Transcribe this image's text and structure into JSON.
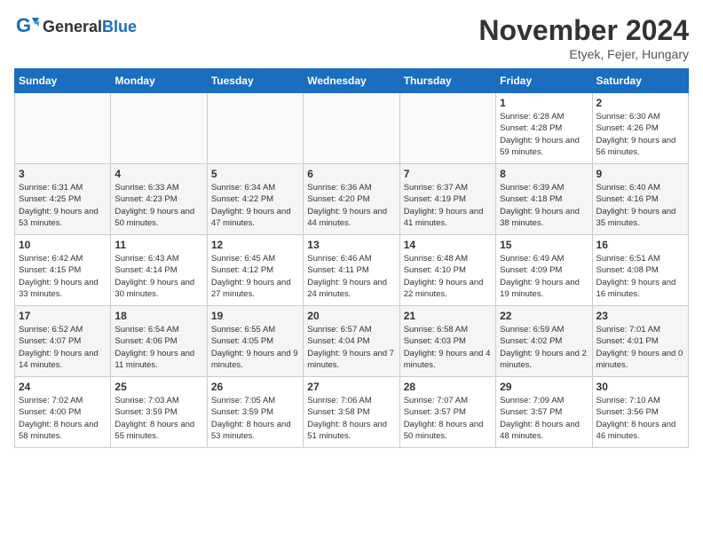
{
  "logo": {
    "general": "General",
    "blue": "Blue"
  },
  "title": "November 2024",
  "location": "Etyek, Fejer, Hungary",
  "weekdays": [
    "Sunday",
    "Monday",
    "Tuesday",
    "Wednesday",
    "Thursday",
    "Friday",
    "Saturday"
  ],
  "weeks": [
    [
      {
        "day": "",
        "info": ""
      },
      {
        "day": "",
        "info": ""
      },
      {
        "day": "",
        "info": ""
      },
      {
        "day": "",
        "info": ""
      },
      {
        "day": "",
        "info": ""
      },
      {
        "day": "1",
        "info": "Sunrise: 6:28 AM\nSunset: 4:28 PM\nDaylight: 9 hours and 59 minutes."
      },
      {
        "day": "2",
        "info": "Sunrise: 6:30 AM\nSunset: 4:26 PM\nDaylight: 9 hours and 56 minutes."
      }
    ],
    [
      {
        "day": "3",
        "info": "Sunrise: 6:31 AM\nSunset: 4:25 PM\nDaylight: 9 hours and 53 minutes."
      },
      {
        "day": "4",
        "info": "Sunrise: 6:33 AM\nSunset: 4:23 PM\nDaylight: 9 hours and 50 minutes."
      },
      {
        "day": "5",
        "info": "Sunrise: 6:34 AM\nSunset: 4:22 PM\nDaylight: 9 hours and 47 minutes."
      },
      {
        "day": "6",
        "info": "Sunrise: 6:36 AM\nSunset: 4:20 PM\nDaylight: 9 hours and 44 minutes."
      },
      {
        "day": "7",
        "info": "Sunrise: 6:37 AM\nSunset: 4:19 PM\nDaylight: 9 hours and 41 minutes."
      },
      {
        "day": "8",
        "info": "Sunrise: 6:39 AM\nSunset: 4:18 PM\nDaylight: 9 hours and 38 minutes."
      },
      {
        "day": "9",
        "info": "Sunrise: 6:40 AM\nSunset: 4:16 PM\nDaylight: 9 hours and 35 minutes."
      }
    ],
    [
      {
        "day": "10",
        "info": "Sunrise: 6:42 AM\nSunset: 4:15 PM\nDaylight: 9 hours and 33 minutes."
      },
      {
        "day": "11",
        "info": "Sunrise: 6:43 AM\nSunset: 4:14 PM\nDaylight: 9 hours and 30 minutes."
      },
      {
        "day": "12",
        "info": "Sunrise: 6:45 AM\nSunset: 4:12 PM\nDaylight: 9 hours and 27 minutes."
      },
      {
        "day": "13",
        "info": "Sunrise: 6:46 AM\nSunset: 4:11 PM\nDaylight: 9 hours and 24 minutes."
      },
      {
        "day": "14",
        "info": "Sunrise: 6:48 AM\nSunset: 4:10 PM\nDaylight: 9 hours and 22 minutes."
      },
      {
        "day": "15",
        "info": "Sunrise: 6:49 AM\nSunset: 4:09 PM\nDaylight: 9 hours and 19 minutes."
      },
      {
        "day": "16",
        "info": "Sunrise: 6:51 AM\nSunset: 4:08 PM\nDaylight: 9 hours and 16 minutes."
      }
    ],
    [
      {
        "day": "17",
        "info": "Sunrise: 6:52 AM\nSunset: 4:07 PM\nDaylight: 9 hours and 14 minutes."
      },
      {
        "day": "18",
        "info": "Sunrise: 6:54 AM\nSunset: 4:06 PM\nDaylight: 9 hours and 11 minutes."
      },
      {
        "day": "19",
        "info": "Sunrise: 6:55 AM\nSunset: 4:05 PM\nDaylight: 9 hours and 9 minutes."
      },
      {
        "day": "20",
        "info": "Sunrise: 6:57 AM\nSunset: 4:04 PM\nDaylight: 9 hours and 7 minutes."
      },
      {
        "day": "21",
        "info": "Sunrise: 6:58 AM\nSunset: 4:03 PM\nDaylight: 9 hours and 4 minutes."
      },
      {
        "day": "22",
        "info": "Sunrise: 6:59 AM\nSunset: 4:02 PM\nDaylight: 9 hours and 2 minutes."
      },
      {
        "day": "23",
        "info": "Sunrise: 7:01 AM\nSunset: 4:01 PM\nDaylight: 9 hours and 0 minutes."
      }
    ],
    [
      {
        "day": "24",
        "info": "Sunrise: 7:02 AM\nSunset: 4:00 PM\nDaylight: 8 hours and 58 minutes."
      },
      {
        "day": "25",
        "info": "Sunrise: 7:03 AM\nSunset: 3:59 PM\nDaylight: 8 hours and 55 minutes."
      },
      {
        "day": "26",
        "info": "Sunrise: 7:05 AM\nSunset: 3:59 PM\nDaylight: 8 hours and 53 minutes."
      },
      {
        "day": "27",
        "info": "Sunrise: 7:06 AM\nSunset: 3:58 PM\nDaylight: 8 hours and 51 minutes."
      },
      {
        "day": "28",
        "info": "Sunrise: 7:07 AM\nSunset: 3:57 PM\nDaylight: 8 hours and 50 minutes."
      },
      {
        "day": "29",
        "info": "Sunrise: 7:09 AM\nSunset: 3:57 PM\nDaylight: 8 hours and 48 minutes."
      },
      {
        "day": "30",
        "info": "Sunrise: 7:10 AM\nSunset: 3:56 PM\nDaylight: 8 hours and 46 minutes."
      }
    ]
  ]
}
